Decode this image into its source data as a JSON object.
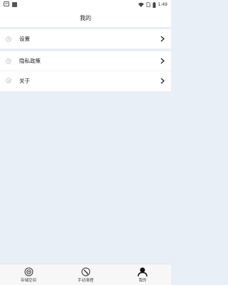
{
  "status_bar": {
    "left_icons": [
      "notification-icon",
      "app-square-icon"
    ],
    "time": "1:49"
  },
  "header": {
    "title": "我的"
  },
  "groups": [
    {
      "items": [
        {
          "label": "设置",
          "icon": "settings-dot-icon"
        }
      ]
    },
    {
      "items": [
        {
          "label": "隐私政策",
          "icon": "privacy-dot-icon"
        },
        {
          "label": "关于",
          "icon": "about-dot-icon"
        }
      ]
    }
  ],
  "tab_bar": {
    "tabs": [
      {
        "label": "存储空间",
        "icon": "storage-icon",
        "active": false
      },
      {
        "label": "手动清理",
        "icon": "broom-icon",
        "active": false
      },
      {
        "label": "我的",
        "icon": "user-icon",
        "active": true
      }
    ]
  },
  "colors": {
    "background": "#e9eff7",
    "card": "#ffffff",
    "text": "#222222"
  }
}
